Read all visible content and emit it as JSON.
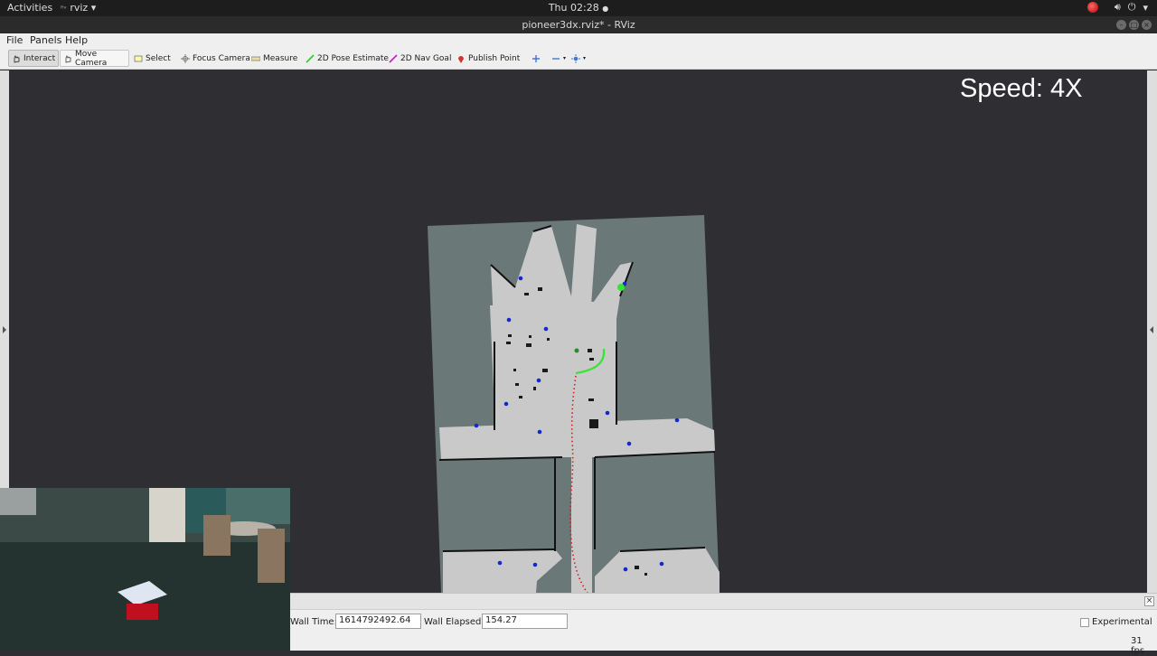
{
  "system_bar": {
    "activities": "Activities",
    "app_menu": "rviz",
    "clock": "Thu 02:28"
  },
  "window": {
    "title": "pioneer3dx.rviz* - RViz"
  },
  "menu": {
    "file": "File",
    "panels": "Panels",
    "help": "Help"
  },
  "toolbar": {
    "interact": "Interact",
    "move_camera": "Move Camera",
    "select": "Select",
    "focus_camera": "Focus Camera",
    "measure": "Measure",
    "pose_estimate": "2D Pose Estimate",
    "nav_goal": "2D Nav Goal",
    "publish_point": "Publish Point"
  },
  "viewport": {
    "overlay_text": "Speed: 4X",
    "colors": {
      "background": "#2f2e33",
      "unknown_area": "#6b7878",
      "free_space": "#c9c9c9",
      "obstacle": "#111111",
      "waypoint": "#1428d2",
      "plan_path": "#32e632",
      "trajectory": "#d01e1e"
    }
  },
  "time_panel": {
    "wall_time_label": "Wall Time:",
    "wall_time_value": "1614792492.64",
    "wall_elapsed_label": "Wall Elapsed:",
    "wall_elapsed_value": "154.27",
    "experimental_label": "Experimental",
    "fps": "31 fps"
  }
}
